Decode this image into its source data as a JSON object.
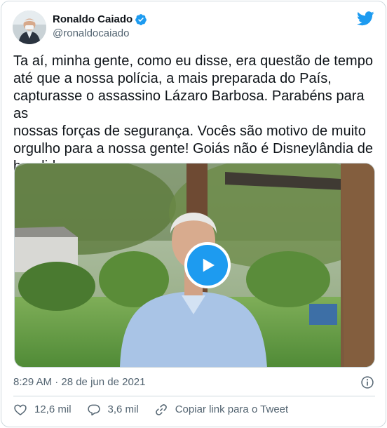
{
  "user": {
    "display_name": "Ronaldo Caiado",
    "handle": "@ronaldocaiado",
    "verified": true
  },
  "tweet": {
    "text": "Ta aí, minha gente, como eu disse, era questão de tempo\naté que a nossa polícia, a mais preparada do País,\ncapturasse o assassino Lázaro Barbosa. Parabéns para as\nnossas forças de segurança. Vocês são motivo de muito\norgulho para a nossa gente! Goiás não é Disneylândia de\nbandido",
    "timestamp": "8:29 AM · 28 de jun de 2021"
  },
  "media": {
    "type": "video",
    "icon": "play-icon"
  },
  "actions": {
    "likes": "12,6 mil",
    "replies": "3,6 mil",
    "copy_link": "Copiar link para o Tweet"
  },
  "colors": {
    "accent": "#1d9bf0",
    "text": "#0f1419",
    "secondary": "#536471",
    "border": "#cfd9de"
  }
}
